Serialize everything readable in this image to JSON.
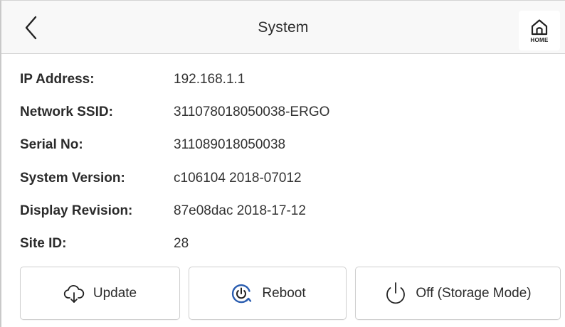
{
  "header": {
    "title": "System",
    "home_label": "HOME"
  },
  "icons": {
    "back": "chevron-left-icon",
    "home": "home-icon",
    "update": "cloud-download-icon",
    "reboot": "power-refresh-icon",
    "off": "power-icon"
  },
  "info": [
    {
      "label": "IP Address:",
      "value": "192.168.1.1"
    },
    {
      "label": "Network SSID:",
      "value": "311078018050038-ERGO"
    },
    {
      "label": "Serial No:",
      "value": "311089018050038"
    },
    {
      "label": "System Version:",
      "value": "c106104 2018-07012"
    },
    {
      "label": "Display Revision:",
      "value": "87e08dac 2018-17-12"
    },
    {
      "label": "Site ID:",
      "value": "28"
    }
  ],
  "buttons": {
    "update_label": "Update",
    "reboot_label": "Reboot",
    "off_label": "Off (Storage Mode)"
  },
  "colors": {
    "header_bg": "#f8f8f8",
    "text": "#2b2b2b",
    "reboot_icon": "#2a5db0",
    "border": "#cfcfcf"
  }
}
